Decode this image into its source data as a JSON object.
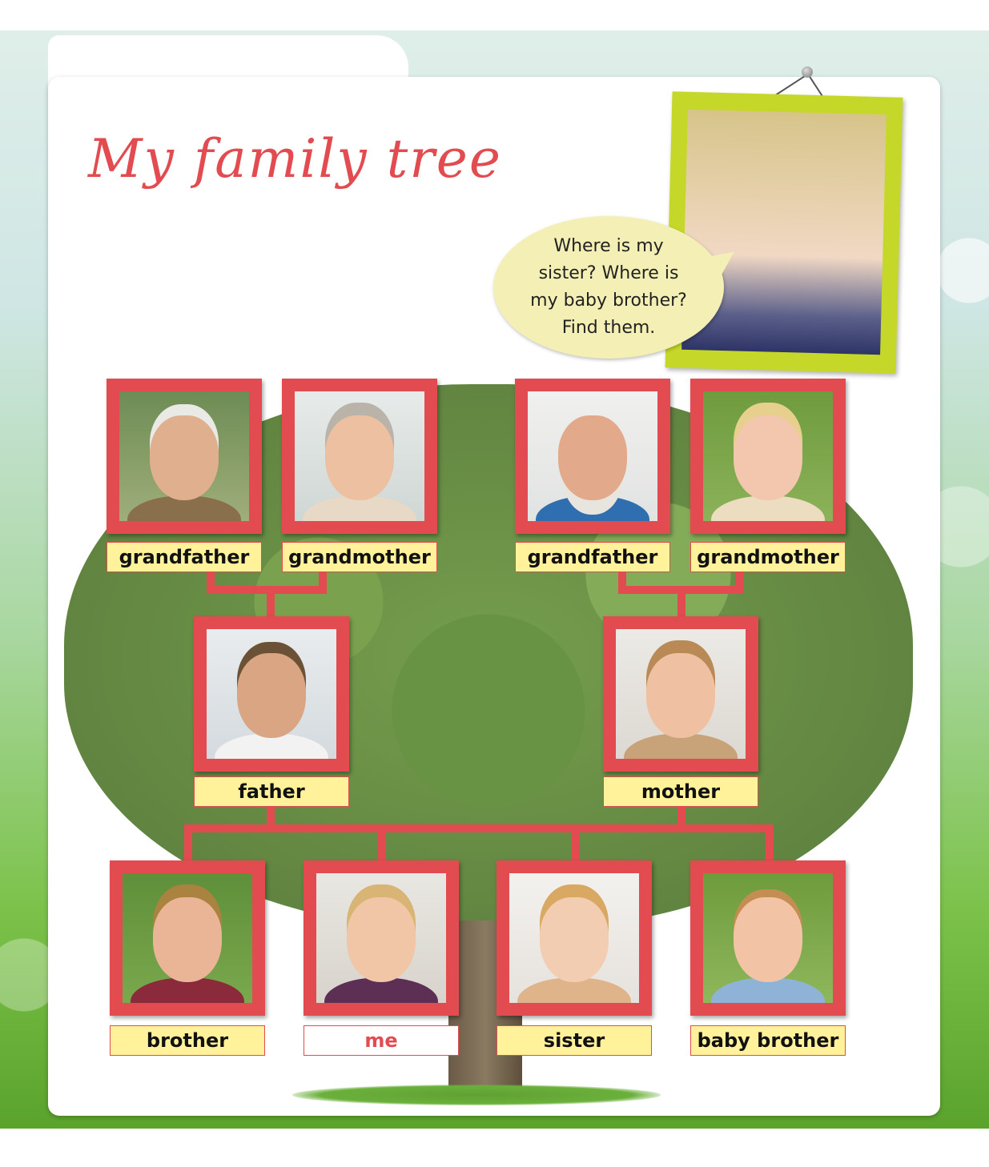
{
  "title": "My family tree",
  "speech_bubble": "Where is my\nsister? Where is\nmy baby brother?\nFind them.",
  "colors": {
    "accent": "#e24b4f",
    "label_bg": "#fff29a",
    "hanging_frame": "#c5d82a",
    "bubble": "#f4f0b5"
  },
  "people": {
    "grandfather_1": "grandfather",
    "grandmother_1": "grandmother",
    "grandfather_2": "grandfather",
    "grandmother_2": "grandmother",
    "father": "father",
    "mother": "mother",
    "brother": "brother",
    "me": "me",
    "sister": "sister",
    "baby_brother": "baby brother"
  }
}
